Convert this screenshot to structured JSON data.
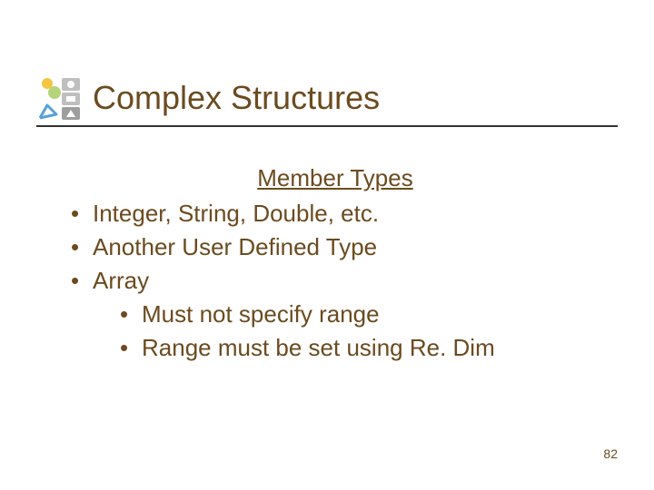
{
  "slide": {
    "title": "Complex Structures",
    "subtitle": "Member Types",
    "bullets": [
      {
        "text": "Integer, String, Double, etc."
      },
      {
        "text": "Another User Defined Type"
      },
      {
        "text": "Array",
        "sub": [
          {
            "text": "Must not specify range"
          },
          {
            "text": "Range must be set using Re. Dim"
          }
        ]
      }
    ],
    "page_number": "82"
  }
}
